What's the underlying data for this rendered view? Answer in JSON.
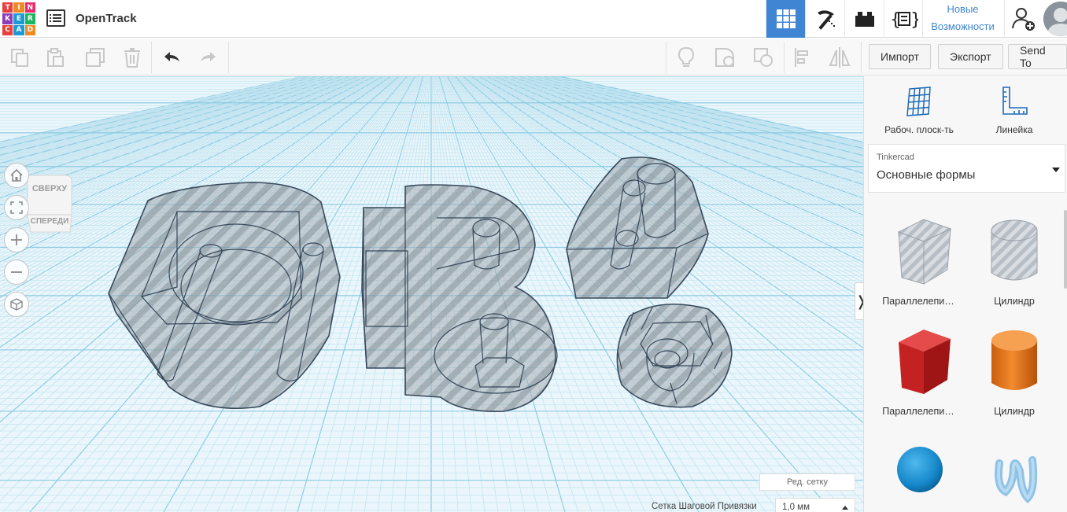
{
  "header": {
    "logo": [
      "TIN",
      "KER",
      "CAD"
    ],
    "project_title": "OpenTrack",
    "top_icons": [
      {
        "name": "3d-design-icon",
        "active": true
      },
      {
        "name": "pickaxe-icon",
        "active": false
      },
      {
        "name": "brick-icon",
        "active": false
      },
      {
        "name": "codeblocks-icon",
        "active": false
      }
    ],
    "whats_new": {
      "line1": "Новые",
      "line2": "Возможности"
    }
  },
  "toolbar": {
    "import_label": "Импорт",
    "export_label": "Экспорт",
    "send_to_label": "Send To"
  },
  "workplane": {
    "view_cube": {
      "top": "СВЕРХУ",
      "front": "СПЕРЕДИ"
    },
    "edit_grid_label": "Ред. сетку",
    "snap_grid_label": "Сетка Шаговой Привязки",
    "snap_grid_value": "1,0 мм"
  },
  "right_panel": {
    "workplane_tool_label": "Рабоч. плоск-ть",
    "ruler_tool_label": "Линейка",
    "library_source": "Tinkercad",
    "library_name": "Основные формы",
    "shapes": [
      {
        "label": "Параллелепи…",
        "icon": "hole-box-icon"
      },
      {
        "label": "Цилиндр",
        "icon": "hole-cylinder-icon"
      },
      {
        "label": "Параллелепи…",
        "icon": "box-icon",
        "color": "#d62b2b"
      },
      {
        "label": "Цилиндр",
        "icon": "cylinder-icon",
        "color": "#e8761c"
      },
      {
        "label": "",
        "icon": "sphere-icon",
        "color": "#1d8fd1"
      },
      {
        "label": "",
        "icon": "scribble-icon",
        "color": "#8fc3e6"
      }
    ]
  },
  "colors": {
    "accent": "#3f85d4",
    "logo_palette": [
      "#e8403a",
      "#f08b23",
      "#ea2b6f",
      "#8f3bb6",
      "#1b9ad6",
      "#1db55f",
      "#e8403a",
      "#1b9ad6",
      "#f08b23"
    ]
  }
}
